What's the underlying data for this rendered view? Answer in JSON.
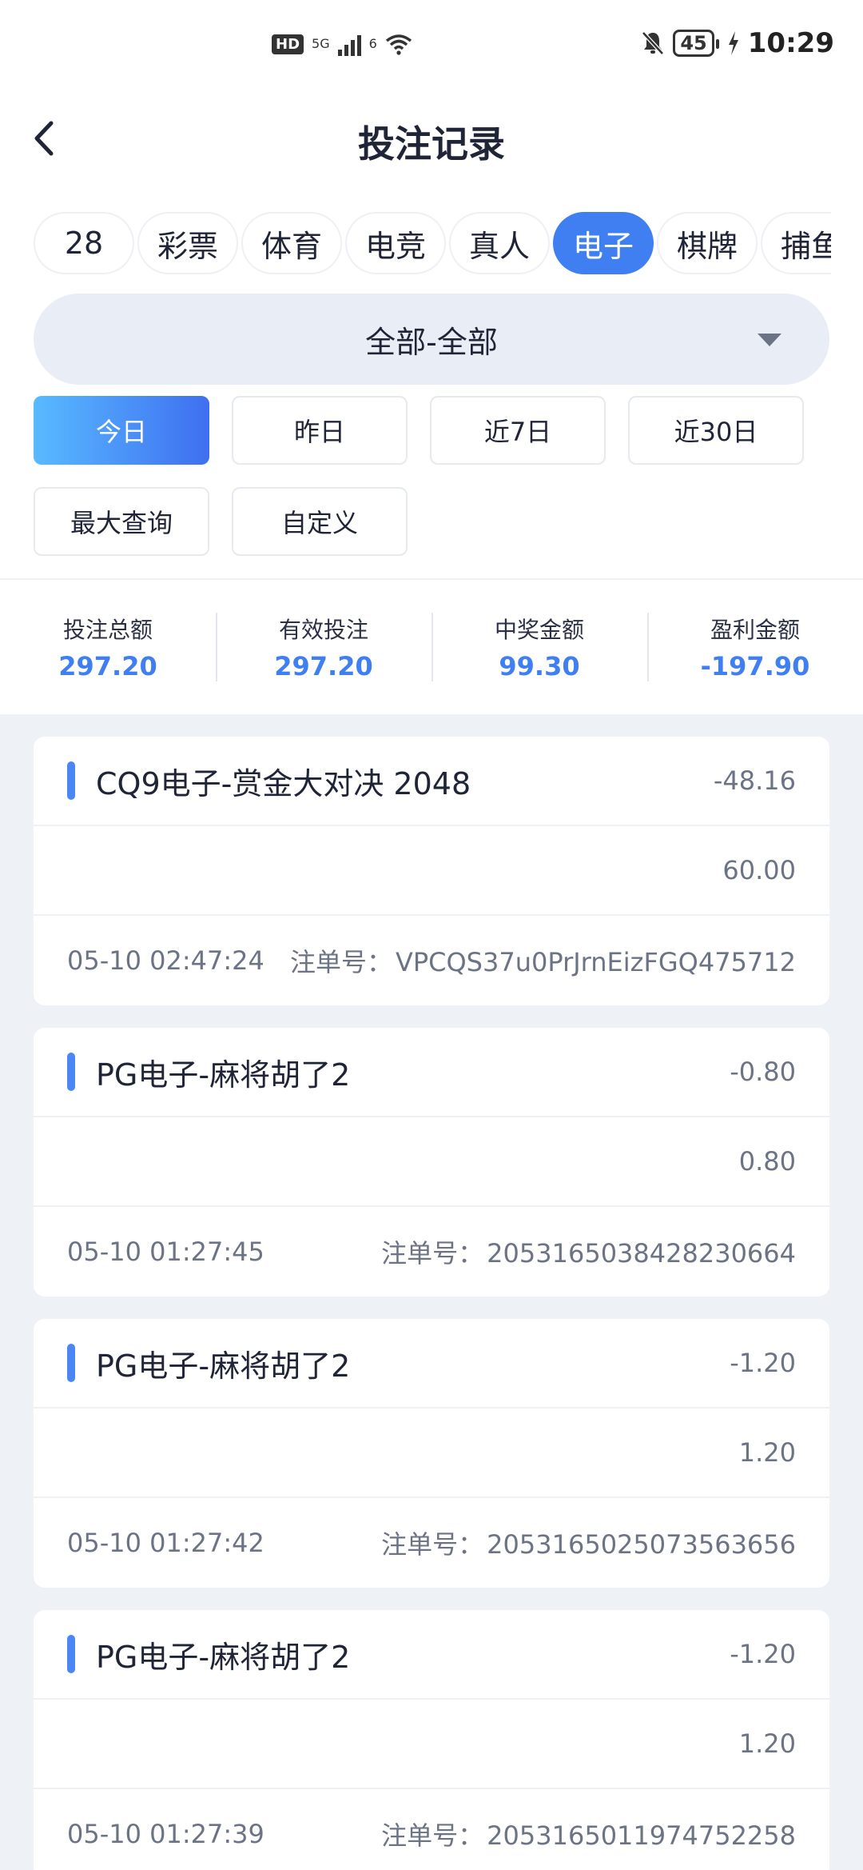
{
  "status_bar": {
    "hd": "HD",
    "network": "5G",
    "sim2": "6",
    "battery": "45",
    "time": "10:29"
  },
  "header": {
    "title": "投注记录"
  },
  "tabs": [
    {
      "label": "28",
      "active": false
    },
    {
      "label": "彩票",
      "active": false
    },
    {
      "label": "体育",
      "active": false
    },
    {
      "label": "电竞",
      "active": false
    },
    {
      "label": "真人",
      "active": false
    },
    {
      "label": "电子",
      "active": true
    },
    {
      "label": "棋牌",
      "active": false
    },
    {
      "label": "捕鱼",
      "active": false
    }
  ],
  "filter": {
    "selected": "全部-全部"
  },
  "dates": [
    "今日",
    "昨日",
    "近7日",
    "近30日",
    "最大查询",
    "自定义"
  ],
  "summary": {
    "total_bet": {
      "label": "投注总额",
      "value": "297.20"
    },
    "valid_bet": {
      "label": "有效投注",
      "value": "297.20"
    },
    "win_amount": {
      "label": "中奖金额",
      "value": "99.30"
    },
    "profit": {
      "label": "盈利金额",
      "value": "-197.90"
    }
  },
  "order_label": "注单号：",
  "records": [
    {
      "game": "CQ9电子-赏金大对决 2048",
      "profit": "-48.16",
      "bet": "60.00",
      "time": "05-10 02:47:24",
      "order_no": "VPCQS37u0PrJrnEizFGQ475712"
    },
    {
      "game": "PG电子-麻将胡了2",
      "profit": "-0.80",
      "bet": "0.80",
      "time": "05-10 01:27:45",
      "order_no": "2053165038428230664"
    },
    {
      "game": "PG电子-麻将胡了2",
      "profit": "-1.20",
      "bet": "1.20",
      "time": "05-10 01:27:42",
      "order_no": "2053165025073563656"
    },
    {
      "game": "PG电子-麻将胡了2",
      "profit": "-1.20",
      "bet": "1.20",
      "time": "05-10 01:27:39",
      "order_no": "2053165011974752258"
    }
  ],
  "colors": {
    "accent": "#3f7ff2",
    "page_bg": "#eef1f6",
    "text_primary": "#1f2437",
    "text_secondary": "#6b7384"
  },
  "icons": {
    "back": "chevron-left-icon",
    "dropdown": "caret-down-icon",
    "mute": "bell-off-icon",
    "wifi": "wifi-icon",
    "charging": "lightning-icon"
  }
}
